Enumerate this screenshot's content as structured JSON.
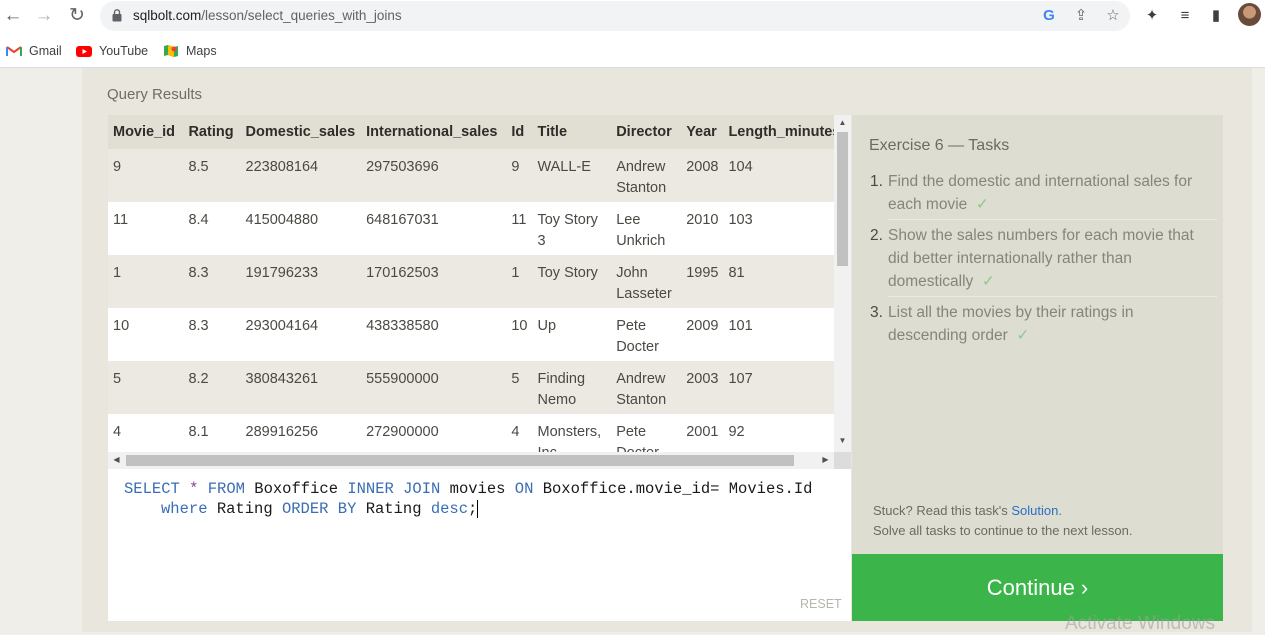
{
  "browser": {
    "url_domain": "sqlbolt.com",
    "url_path": "/lesson/select_queries_with_joins",
    "bookmarks": [
      {
        "label": "Gmail",
        "icon": "gmail-icon"
      },
      {
        "label": "YouTube",
        "icon": "youtube-icon"
      },
      {
        "label": "Maps",
        "icon": "maps-icon"
      }
    ]
  },
  "results": {
    "label": "Query Results",
    "columns": [
      "Movie_id",
      "Rating",
      "Domestic_sales",
      "International_sales",
      "Id",
      "Title",
      "Director",
      "Year",
      "Length_minutes"
    ],
    "rows": [
      [
        "9",
        "8.5",
        "223808164",
        "297503696",
        "9",
        "WALL-E",
        "Andrew Stanton",
        "2008",
        "104"
      ],
      [
        "11",
        "8.4",
        "415004880",
        "648167031",
        "11",
        "Toy Story 3",
        "Lee Unkrich",
        "2010",
        "103"
      ],
      [
        "1",
        "8.3",
        "191796233",
        "170162503",
        "1",
        "Toy Story",
        "John Lasseter",
        "1995",
        "81"
      ],
      [
        "10",
        "8.3",
        "293004164",
        "438338580",
        "10",
        "Up",
        "Pete Docter",
        "2009",
        "101"
      ],
      [
        "5",
        "8.2",
        "380843261",
        "555900000",
        "5",
        "Finding Nemo",
        "Andrew Stanton",
        "2003",
        "107"
      ],
      [
        "4",
        "8.1",
        "289916256",
        "272900000",
        "4",
        "Monsters, Inc.",
        "Pete Docter",
        "2001",
        "92"
      ]
    ]
  },
  "editor": {
    "line1": [
      "SELECT",
      "*",
      "FROM",
      "Boxoffice",
      "INNER JOIN",
      "movies",
      "ON",
      "Boxoffice.movie_id=",
      "Movies.Id"
    ],
    "line2": [
      "where",
      "Rating",
      "ORDER BY",
      "Rating",
      "desc",
      ";"
    ],
    "reset_label": "RESET"
  },
  "tasks": {
    "title": "Exercise 6 — Tasks",
    "items": [
      {
        "num": "1.",
        "text": "Find the domestic and international sales for each movie",
        "check": "✓"
      },
      {
        "num": "2.",
        "text": "Show the sales numbers for each movie that did better internationally rather than domestically",
        "check": "✓"
      },
      {
        "num": "3.",
        "text": "List all the movies by their ratings in descending order",
        "check": "✓"
      }
    ],
    "stuck_prefix": "Stuck? Read this task's ",
    "solution_link": "Solution",
    "stuck_suffix": ".",
    "solve_all": "Solve all tasks to continue to the next lesson."
  },
  "continue_label": "Continue ›",
  "watermark": "Activate Windows"
}
